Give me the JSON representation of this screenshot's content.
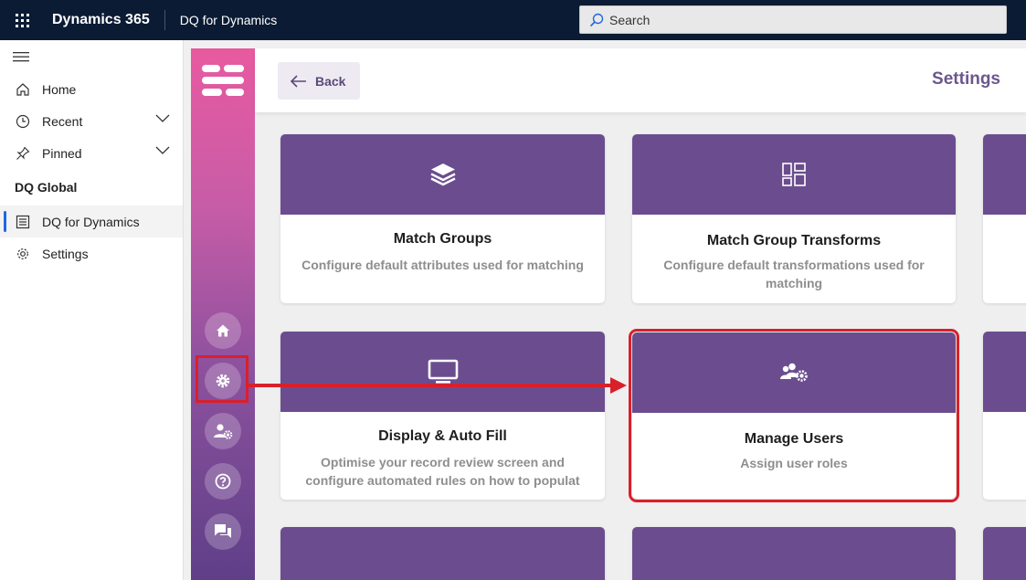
{
  "topbar": {
    "brand": "Dynamics 365",
    "app_name": "DQ for Dynamics",
    "search_placeholder": "Search"
  },
  "leftnav": {
    "items": [
      {
        "label": "Home",
        "icon": "home-icon"
      },
      {
        "label": "Recent",
        "icon": "clock-icon"
      },
      {
        "label": "Pinned",
        "icon": "pin-icon"
      }
    ],
    "group": "DQ Global",
    "group_items": [
      {
        "label": "DQ for Dynamics",
        "icon": "list-icon",
        "selected": true
      },
      {
        "label": "Settings",
        "icon": "gear-icon"
      }
    ]
  },
  "header": {
    "back_label": "Back",
    "title": "Settings"
  },
  "cards": [
    {
      "title": "Match Groups",
      "desc": "Configure default attributes used for matching",
      "icon": "layers-icon"
    },
    {
      "title": "Match Group Transforms",
      "desc": "Configure default transformations used for matching",
      "icon": "grid-icon"
    },
    {
      "title": "Display & Auto Fill",
      "desc": "Optimise your record review screen and configure automated rules on how to populat …",
      "icon": "monitor-icon"
    },
    {
      "title": "Manage Users",
      "desc": "Assign user roles",
      "icon": "users-gear-icon"
    }
  ],
  "colors": {
    "accent": "#6b4d8f",
    "highlight": "#d9202a",
    "topbar": "#0b1b34"
  }
}
